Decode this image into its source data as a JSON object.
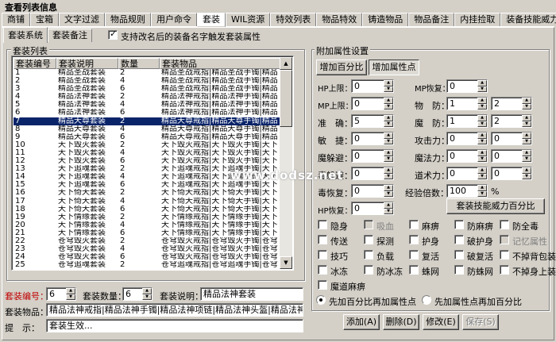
{
  "window": {
    "title": "查看列表信息"
  },
  "main_tabs": [
    "商铺",
    "宝箱",
    "文字过滤",
    "物品规则",
    "用户命令",
    "套装",
    "WIL资源",
    "特效列表",
    "物品特效",
    "铸造物品",
    "物品备注",
    "内挂捡取",
    "装备技能威力"
  ],
  "sub_tabs": [
    "套装系统",
    "套装备注"
  ],
  "support_check": {
    "label": "支持改名后的装备名字触发套装属性",
    "checked": true
  },
  "list_group": {
    "label": "套装列表"
  },
  "list": {
    "headers": [
      "套装编号",
      "套装说明",
      "数量",
      "套装物品"
    ],
    "selected_index": 6,
    "rows": [
      {
        "id": "1",
        "desc": "精品圣战套装",
        "count": "2",
        "items": "精品圣战戒指|精品圣战手镯|精品"
      },
      {
        "id": "2",
        "desc": "精品圣战套装",
        "count": "4",
        "items": "精品圣战戒指|精品圣战手镯|精品"
      },
      {
        "id": "3",
        "desc": "精品圣战套装",
        "count": "6",
        "items": "精品圣战戒指|精品圣战手镯|精品"
      },
      {
        "id": "4",
        "desc": "精品法神套装",
        "count": "2",
        "items": "精品法神戒指|精品法神手镯|精品"
      },
      {
        "id": "5",
        "desc": "精品法神套装",
        "count": "4",
        "items": "精品法神戒指|精品法神手镯|精品"
      },
      {
        "id": "6",
        "desc": "精品法神套装",
        "count": "6",
        "items": "精品法神戒指|精品法神手镯|精品"
      },
      {
        "id": "7",
        "desc": "精品天尊套装",
        "count": "2",
        "items": "精品天尊戒指|精品天尊手镯|精品"
      },
      {
        "id": "8",
        "desc": "精品天尊套装",
        "count": "4",
        "items": "精品天尊戒指|精品天尊手镯|精品"
      },
      {
        "id": "9",
        "desc": "精品天尊套装",
        "count": "6",
        "items": "精品天尊戒指|精品天尊手镯|精品"
      },
      {
        "id": "10",
        "desc": "天下毁灭套装",
        "count": "2",
        "items": "天下毁灭戒指|天下毁灭手镯|天下"
      },
      {
        "id": "11",
        "desc": "天下毁灭套装",
        "count": "4",
        "items": "天下毁灭戒指|天下毁灭手镯|天下"
      },
      {
        "id": "12",
        "desc": "天下毁灭套装",
        "count": "6",
        "items": "天下毁灭戒指|天下毁灭手镯|天下"
      },
      {
        "id": "13",
        "desc": "天下追魂套装",
        "count": "2",
        "items": "天下追魂戒指|天下追魂手镯|天下"
      },
      {
        "id": "14",
        "desc": "天下追魂套装",
        "count": "4",
        "items": "天下追魂戒指|天下追魂手镯|天下"
      },
      {
        "id": "15",
        "desc": "天下追魂套装",
        "count": "6",
        "items": "天下追魂戒指|天下追魂手镯|天下"
      },
      {
        "id": "16",
        "desc": "天下倚天套装",
        "count": "2",
        "items": "天下倚天戒指|天下倚天手镯|天下"
      },
      {
        "id": "17",
        "desc": "天下倚天套装",
        "count": "4",
        "items": "天下倚天戒指|天下倚天手镯|天下"
      },
      {
        "id": "18",
        "desc": "天下倚天套装",
        "count": "6",
        "items": "天下倚天戒指|天下倚天手镯|天下"
      },
      {
        "id": "19",
        "desc": "天下情缘套装",
        "count": "2",
        "items": "天下情缘戒指|天下情缘手镯|天下"
      },
      {
        "id": "20",
        "desc": "天下情缘套装",
        "count": "4",
        "items": "天下情缘戒指|天下情缘手镯|天下"
      },
      {
        "id": "21",
        "desc": "天下情缘套装",
        "count": "6",
        "items": "天下情缘戒指|天下情缘手镯|天下"
      },
      {
        "id": "22",
        "desc": "苍穹毁灭套装",
        "count": "2",
        "items": "苍穹毁灭戒指|苍穹毁灭手镯|苍穹"
      },
      {
        "id": "23",
        "desc": "苍穹毁灭套装",
        "count": "4",
        "items": "苍穹毁灭戒指|苍穹毁灭手镯|苍穹"
      },
      {
        "id": "24",
        "desc": "苍穹毁灭套装",
        "count": "6",
        "items": "苍穹毁灭戒指|苍穹毁灭手镯|苍穹"
      },
      {
        "id": "25",
        "desc": "苍穹追魂套装",
        "count": "2",
        "items": "苍穹追魂戒指|苍穹追魂手镯|苍穹"
      }
    ]
  },
  "bottom": {
    "suit_no_label": "套装编号：",
    "suit_no_value": "6",
    "count_label": "套装数量：",
    "count_value": "6",
    "desc_label": "套装说明：",
    "desc_value": "精品法神套装",
    "items_label": "套装物品：",
    "items_value": "精品法神戒指|精品法神手镯|精品法神项链|精品法神头盔|精品法神靴",
    "hint_label": "提　示：",
    "hint_value": "套装生效..."
  },
  "attr_group": {
    "label": "附加属性设置",
    "tabs": [
      "增加百分比",
      "增加属性点"
    ],
    "active_tab": 1
  },
  "attr_left": [
    {
      "label": "HP上限：",
      "value": "0"
    },
    {
      "label": "MP上限：",
      "value": "0"
    },
    {
      "label": "准　确：",
      "value": "5"
    },
    {
      "label": "敏　捷：",
      "value": "0"
    },
    {
      "label": "魔躲避：",
      "value": "0"
    },
    {
      "label": "毒躲避：",
      "value": "0"
    },
    {
      "label": "毒恢复：",
      "value": "0"
    },
    {
      "label": "HP恢复：",
      "value": "0"
    }
  ],
  "attr_right": {
    "mp_recover": {
      "label": "MP恢复：",
      "value": "0"
    },
    "phys_def": {
      "label": "物　防：",
      "min": "1",
      "max": "2"
    },
    "magic_def": {
      "label": "魔　防：",
      "min": "1",
      "max": "2"
    },
    "attack": {
      "label": "攻击力：",
      "min": "0",
      "max": "0"
    },
    "magic": {
      "label": "魔法力：",
      "min": "0",
      "max": "0"
    },
    "tao": {
      "label": "道术力：",
      "min": "0",
      "max": "0"
    },
    "exp": {
      "label": "经验倍数：",
      "value": "100",
      "unit": "%"
    }
  },
  "skill_button": "套装技能威力百分比",
  "flags": [
    {
      "label": "隐身",
      "checked": false,
      "disabled": false
    },
    {
      "label": "吸血",
      "checked": false,
      "disabled": true
    },
    {
      "label": "麻痹",
      "checked": false,
      "disabled": false
    },
    {
      "label": "防麻痹",
      "checked": false,
      "disabled": false
    },
    {
      "label": "防全毒",
      "checked": false,
      "disabled": false
    },
    {
      "label": "传送",
      "checked": false,
      "disabled": false
    },
    {
      "label": "探测",
      "checked": false,
      "disabled": false
    },
    {
      "label": "护身",
      "checked": false,
      "disabled": false
    },
    {
      "label": "破护身",
      "checked": false,
      "disabled": false
    },
    {
      "label": "记忆属性",
      "checked": false,
      "disabled": true
    },
    {
      "label": "技巧",
      "checked": false,
      "disabled": false
    },
    {
      "label": "负载",
      "checked": false,
      "disabled": false
    },
    {
      "label": "复活",
      "checked": false,
      "disabled": false
    },
    {
      "label": "破复活",
      "checked": false,
      "disabled": false
    },
    {
      "label": "不掉背包装备",
      "checked": false,
      "disabled": false
    },
    {
      "label": "冰冻",
      "checked": false,
      "disabled": false
    },
    {
      "label": "防冰冻",
      "checked": false,
      "disabled": false
    },
    {
      "label": "蛛网",
      "checked": false,
      "disabled": false
    },
    {
      "label": "防蛛网",
      "checked": false,
      "disabled": false
    },
    {
      "label": "不掉身上装备",
      "checked": false,
      "disabled": false
    },
    {
      "label": "魔道麻痹",
      "checked": false,
      "disabled": false
    }
  ],
  "radio": [
    {
      "label": "先加百分比再加属性点",
      "selected": true
    },
    {
      "label": "先加属性点再加百分比",
      "selected": false
    }
  ],
  "actions": {
    "add": "添加(A)",
    "delete": "删除(D)",
    "modify": "修改(E)",
    "save": "保存(S)"
  },
  "watermark": "www.dodsz.net"
}
